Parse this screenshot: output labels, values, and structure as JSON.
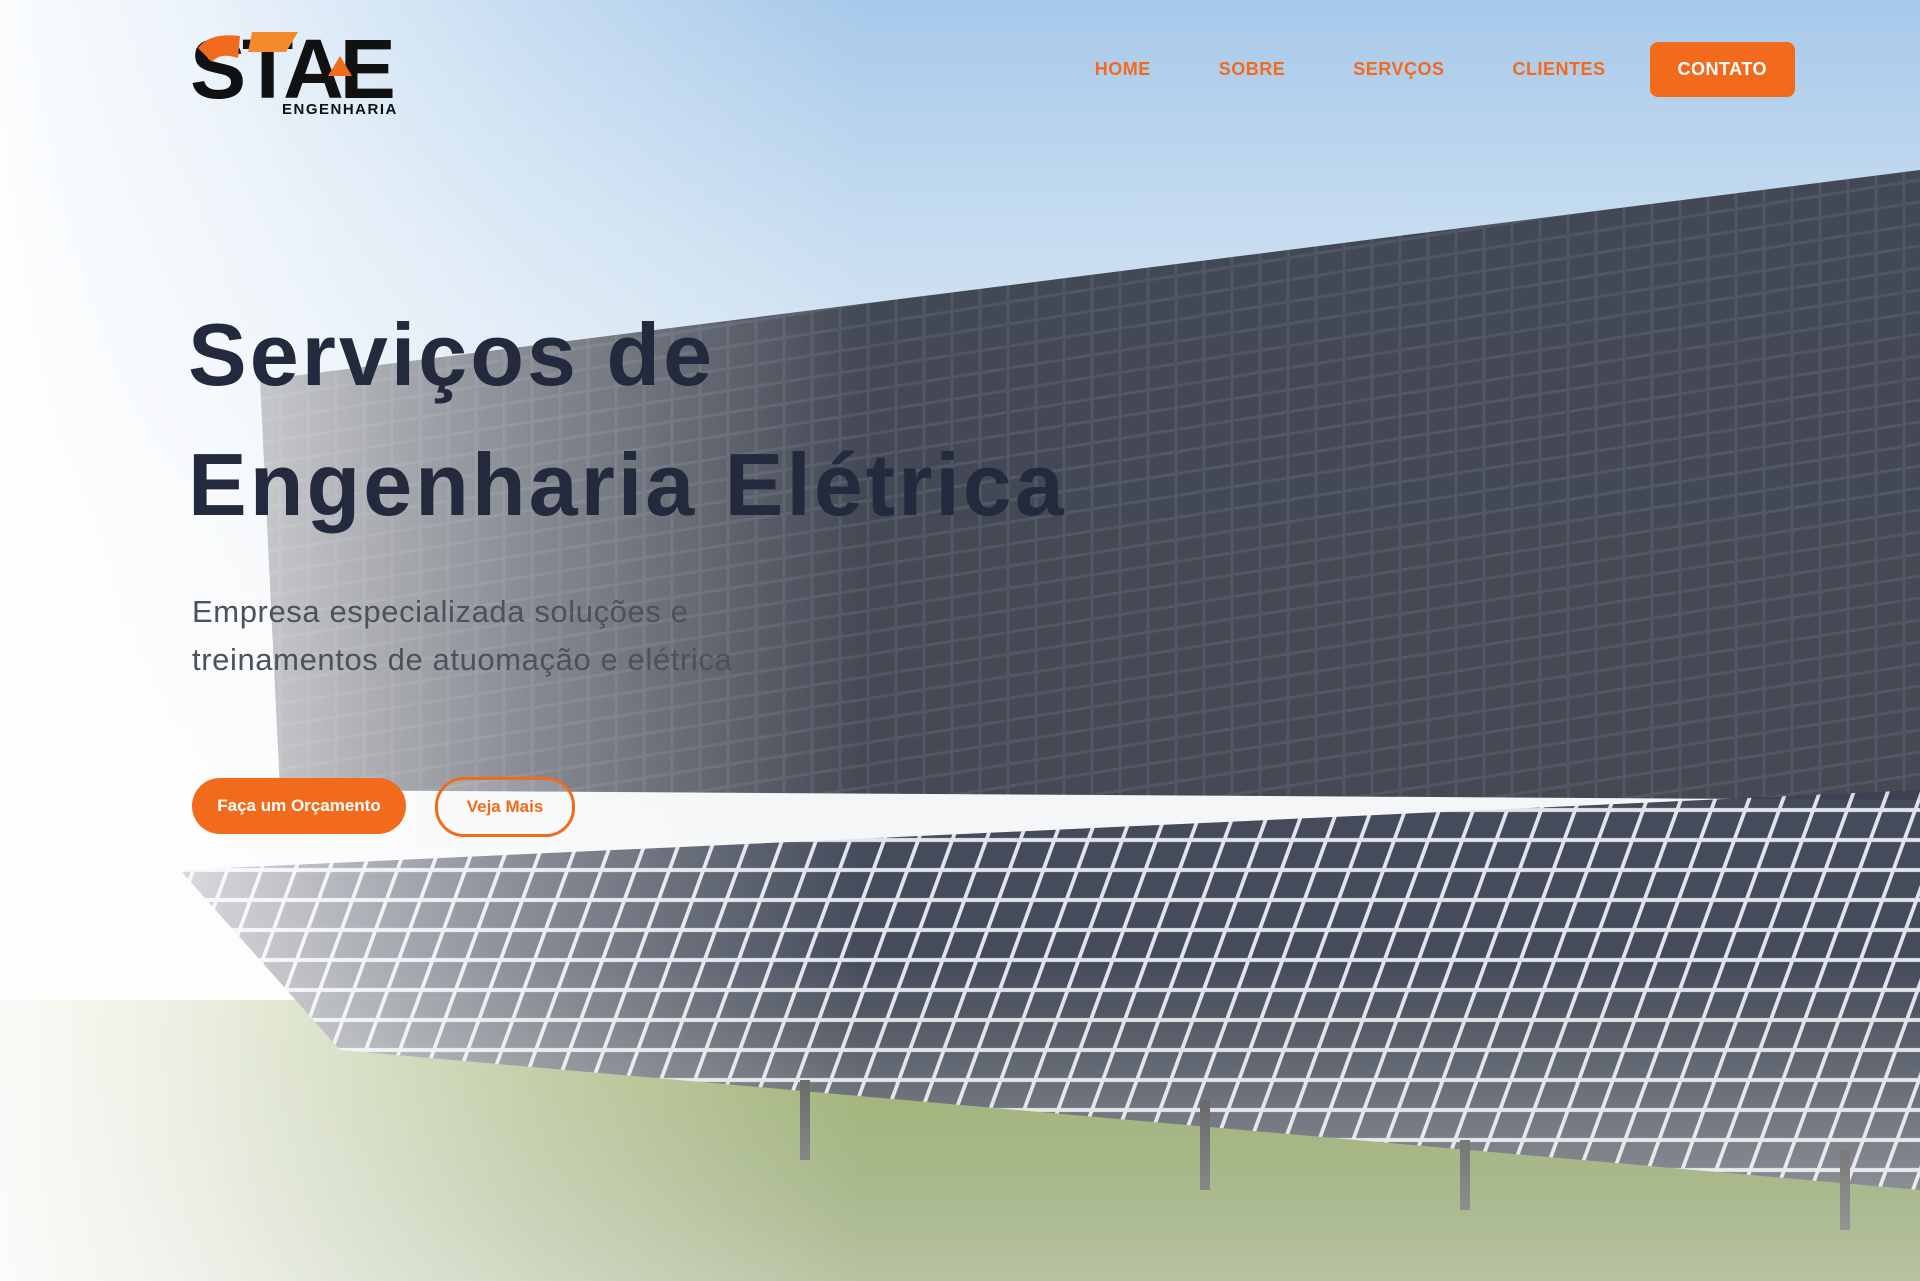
{
  "brand": {
    "logo_text": "STAE",
    "logo_subtext": "ENGENHARIA",
    "primary_color": "#f26b1d",
    "dark_color": "#232a3d"
  },
  "nav": {
    "items": [
      {
        "label": "HOME"
      },
      {
        "label": "SOBRE"
      },
      {
        "label": "SERVÇOS"
      },
      {
        "label": "CLIENTES"
      }
    ],
    "cta_label": "CONTATO"
  },
  "hero": {
    "title_line1": "Serviços de",
    "title_line2": "Engenharia Elétrica",
    "subtitle_line1": "Empresa especializada soluções e",
    "subtitle_line2": "treinamentos de atuomação e elétrica",
    "primary_button": "Faça um Orçamento",
    "secondary_button": "Veja Mais",
    "background_image": "solar-panels-photo"
  }
}
